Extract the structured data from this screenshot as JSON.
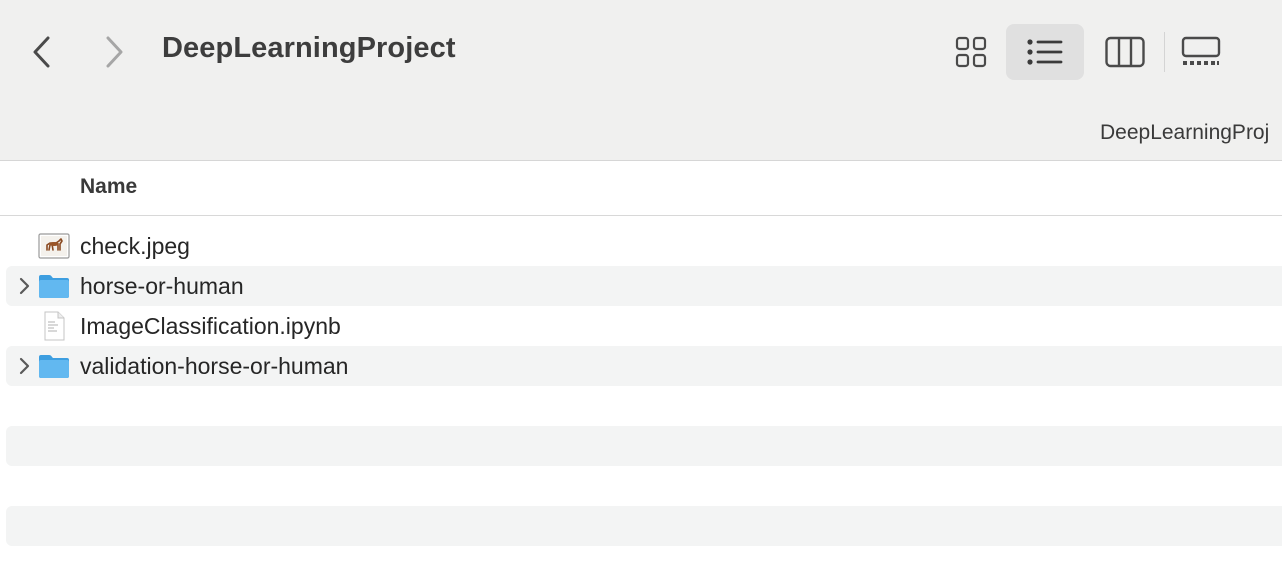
{
  "window": {
    "title": "DeepLearningProject",
    "path_label": "DeepLearningProj"
  },
  "toolbar": {
    "back_icon": "chevron-left-icon",
    "forward_icon": "chevron-right-icon",
    "views": [
      {
        "name": "icons",
        "icon": "grid-icon",
        "selected": false
      },
      {
        "name": "list",
        "icon": "list-icon",
        "selected": true
      },
      {
        "name": "columns",
        "icon": "columns-icon",
        "selected": false
      },
      {
        "name": "gallery",
        "icon": "gallery-icon",
        "selected": false
      }
    ]
  },
  "columns": {
    "name_header": "Name"
  },
  "files": [
    {
      "name": "check.jpeg",
      "kind": "image",
      "icon": "image-thumbnail-icon",
      "expandable": false
    },
    {
      "name": "horse-or-human",
      "kind": "folder",
      "icon": "folder-icon",
      "expandable": true
    },
    {
      "name": "ImageClassification.ipynb",
      "kind": "document",
      "icon": "document-icon",
      "expandable": false
    },
    {
      "name": "validation-horse-or-human",
      "kind": "folder",
      "icon": "folder-icon",
      "expandable": true
    }
  ],
  "colors": {
    "toolbar_bg": "#f0f0ef",
    "selected_view_bg": "#e0e0e0",
    "row_alt_bg": "#f3f4f4",
    "folder_blue": "#5db5ee"
  }
}
